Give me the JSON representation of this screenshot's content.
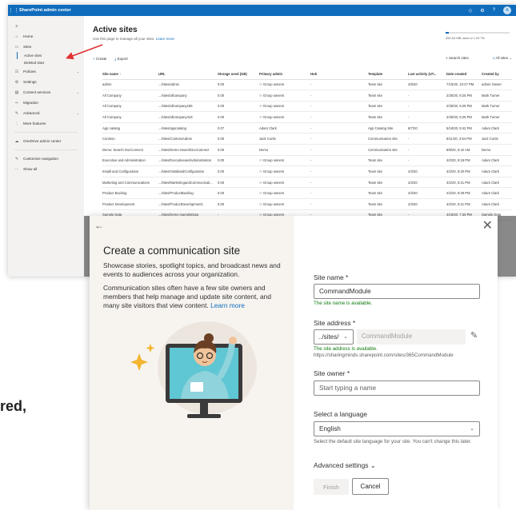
{
  "topbar": {
    "title": "SharePoint admin center",
    "avatar": "A"
  },
  "nav": {
    "items": [
      {
        "label": "Home"
      },
      {
        "label": "Sites"
      },
      {
        "label": "Policies"
      },
      {
        "label": "Settings"
      },
      {
        "label": "Content services"
      },
      {
        "label": "Migration"
      },
      {
        "label": "Advanced"
      },
      {
        "label": "More features"
      },
      {
        "label": "OneDrive admin center"
      },
      {
        "label": "Customize navigation"
      },
      {
        "label": "Show all"
      }
    ],
    "sites_sub": [
      "Active sites",
      "Deleted sites"
    ]
  },
  "main": {
    "title": "Active sites",
    "subtitle": "Use this page to manage all your sites.",
    "learn_more": "Learn more",
    "storage_text": "350.00 MB used of 1.00 TB",
    "storage_fraction": 0.05,
    "create": "Create",
    "export": "Export",
    "search_placeholder": "Search sites",
    "filter": "All sites"
  },
  "table": {
    "headers": [
      "Site name ↑",
      "URL",
      "Storage used (GB)",
      "Primary admin",
      "Hub",
      "Template",
      "Last activity (UT...",
      "Date created",
      "Created by"
    ],
    "rows": [
      [
        "admin",
        ".../sites/admin",
        "0.00",
        "Group owners",
        "-",
        "Team site",
        "4/6/20",
        "7/15/20, 10:27 PM",
        "admin Owner"
      ],
      [
        "All Company",
        ".../sites/allcompany",
        "0.00",
        "Group owners",
        "-",
        "Team site",
        "-",
        "2/30/20, 9:25 PM",
        "Mark Turner"
      ],
      [
        "All Company",
        ".../sites/allcompany185",
        "0.00",
        "Group owners",
        "-",
        "Team site",
        "-",
        "2/30/20, 9:25 PM",
        "Mark Turner"
      ],
      [
        "All Company",
        ".../sites/allcompany418",
        "0.00",
        "Group owners",
        "-",
        "Team site",
        "-",
        "2/30/20, 9:25 PM",
        "Mark Turner"
      ],
      [
        "App catalog",
        ".../sites/appcatalog",
        "0.07",
        "Adam Clark",
        "-",
        "App Catalog Site",
        "8/7/20",
        "5/18/20, 8:42 PM",
        "Adam Clark"
      ],
      [
        "Contoso",
        ".../sites/ContosoAdmin",
        "0.00",
        "Jack Curtis",
        "-",
        "Communication site",
        "-",
        "8/11/20, 3:54 PM",
        "Jack Curtis"
      ],
      [
        "Demo: Search DocConnect",
        ".../sites/Demo-SearchDocConnect",
        "0.00",
        "Demo",
        "-",
        "Communication site",
        "-",
        "8/8/20, 5:42 AM",
        "Demo"
      ],
      [
        "Executive and Administration",
        ".../sites/ExecutiveandAdministration",
        "0.00",
        "Group owners",
        "-",
        "Team site",
        "-",
        "4/2/20, 9:18 PM",
        "Adam Clark"
      ],
      [
        "Install and Configuration",
        ".../sites/InstallandConfiguration",
        "0.00",
        "Group owners",
        "-",
        "Team site",
        "4/3/20",
        "4/2/20, 9:20 PM",
        "Adam Clark"
      ],
      [
        "Marketing and Communications",
        ".../sites/MarketingandCommunicati...",
        "0.00",
        "Group owners",
        "-",
        "Team site",
        "4/3/20",
        "4/2/20, 9:21 PM",
        "Adam Clark"
      ],
      [
        "Product Backlog",
        ".../sites/ProductBacklog",
        "0.00",
        "Group owners",
        "-",
        "Team site",
        "4/3/20",
        "4/2/20, 9:29 PM",
        "Adam Clark"
      ],
      [
        "Product Development",
        ".../sites/ProductDevelopment1",
        "0.00",
        "Group owners",
        "-",
        "Team site",
        "4/3/20",
        "4/2/20, 9:21 PM",
        "Adam Clark"
      ],
      [
        "Sample Data",
        ".../sites/Demo-SampleData",
        "-",
        "Group owners",
        "-",
        "Team site",
        "-",
        "4/16/20, 7:30 PM",
        "Sample Data"
      ]
    ]
  },
  "panel": {
    "title": "Create a communication site",
    "desc1": "Showcase stories, spotlight topics, and broadcast news and events to audiences across your organization.",
    "desc2": "Communication sites often have a few site owners and members that help manage and update site content, and many site visitors that view content.",
    "learn_more": "Learn more",
    "site_name_label": "Site name *",
    "site_name_value": "CommandModule",
    "site_name_ok": "The site name is available.",
    "site_address_label": "Site address *",
    "site_address_prefix": "../sites/",
    "site_address_value": "CommandModule",
    "site_address_ok": "The site address is available.",
    "site_address_url": "https://sharingminds.sharepoint.com/sites/365CommandModule",
    "site_owner_label": "Site owner *",
    "site_owner_placeholder": "Start typing a name",
    "language_label": "Select a language",
    "language_value": "English",
    "language_hint": "Select the default site language for your site. You can't change this later.",
    "advanced": "Advanced settings",
    "finish": "Finish",
    "cancel": "Cancel"
  },
  "clipped_text": "red,",
  "colors": {
    "accent": "#0f6cbd",
    "success": "#107c10",
    "annotation": "#e03131"
  }
}
